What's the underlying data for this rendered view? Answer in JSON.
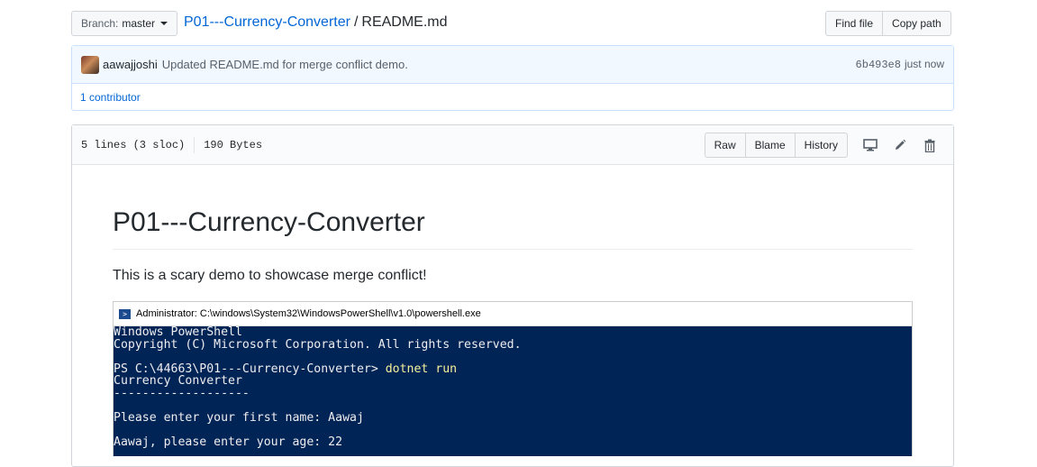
{
  "header": {
    "branch_prefix": "Branch:",
    "branch_name": "master",
    "repo_name": "P01---Currency-Converter",
    "separator": "/",
    "file_name": "README.md",
    "find_file_label": "Find file",
    "copy_path_label": "Copy path"
  },
  "commit": {
    "author": "aawajjoshi",
    "message": "Updated README.md for merge conflict demo.",
    "sha": "6b493e8",
    "time": "just now",
    "contributors": "1 contributor"
  },
  "file": {
    "lines": "5 lines (3 sloc)",
    "size": "190 Bytes",
    "raw_label": "Raw",
    "blame_label": "Blame",
    "history_label": "History",
    "icons": [
      "desktop-icon",
      "pencil-icon",
      "trash-icon"
    ]
  },
  "readme": {
    "title": "P01---Currency-Converter",
    "paragraph": "This is a scary demo to showcase merge conflict!",
    "console": {
      "window_title": "Administrator: C:\\windows\\System32\\WindowsPowerShell\\v1.0\\powershell.exe",
      "lines": [
        {
          "text": "Windows PowerShell",
          "cmd": ""
        },
        {
          "text": "Copyright (C) Microsoft Corporation. All rights reserved.",
          "cmd": ""
        },
        {
          "text": "",
          "cmd": ""
        },
        {
          "text": "PS C:\\44663\\P01---Currency-Converter> ",
          "cmd": "dotnet run"
        },
        {
          "text": "Currency Converter",
          "cmd": ""
        },
        {
          "text": "-------------------",
          "cmd": ""
        },
        {
          "text": "",
          "cmd": ""
        },
        {
          "text": "Please enter your first name: Aawaj",
          "cmd": ""
        },
        {
          "text": "",
          "cmd": ""
        },
        {
          "text": "Aawaj, please enter your age: 22",
          "cmd": ""
        }
      ]
    }
  },
  "colors": {
    "link": "#0366d6",
    "console_bg": "#012456",
    "console_cmd": "#f5f19b"
  }
}
